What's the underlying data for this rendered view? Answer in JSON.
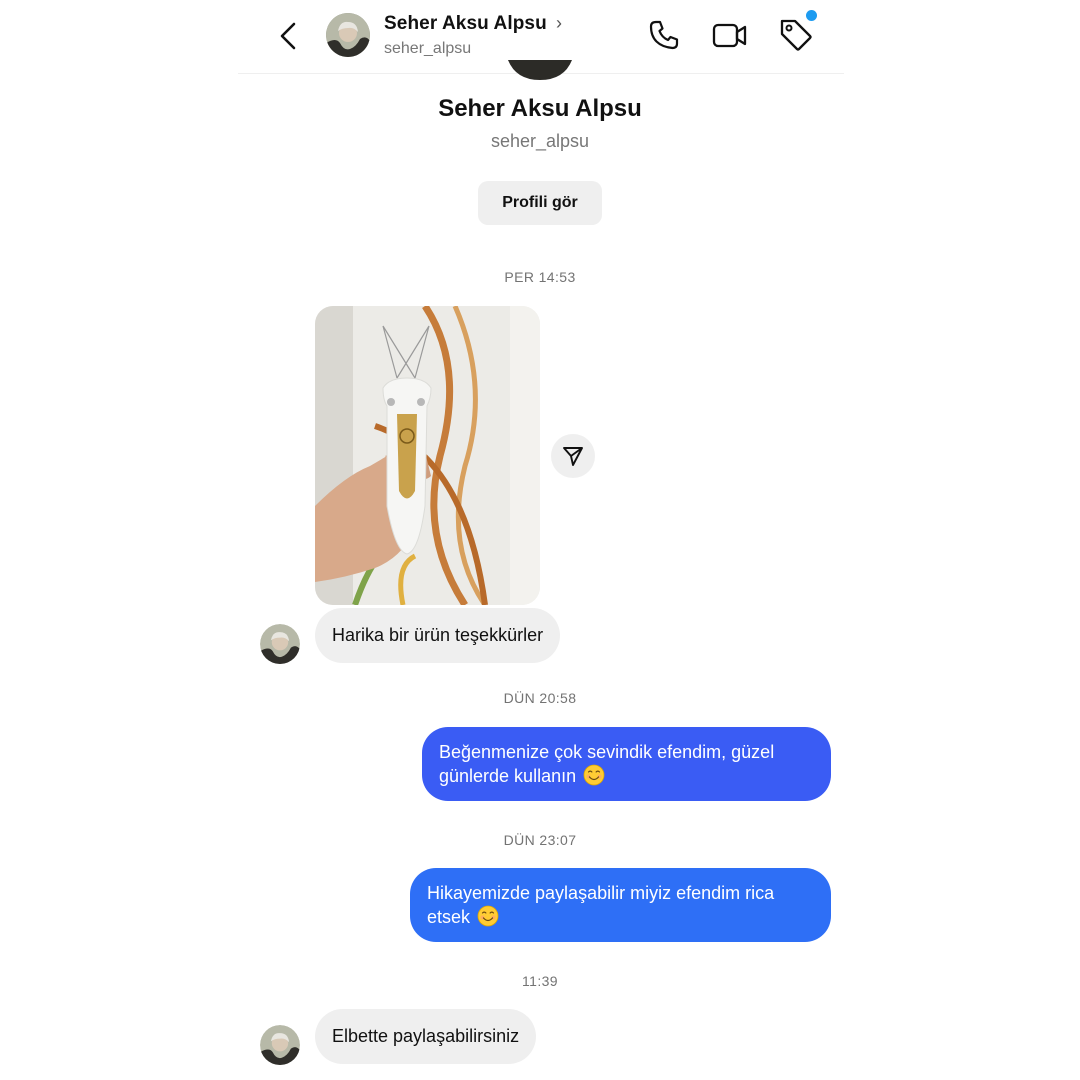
{
  "header": {
    "name": "Seher Aksu Alpsu",
    "username": "seher_alpsu",
    "chevron": "›",
    "icons": [
      "back-icon",
      "phone-icon",
      "video-icon",
      "tag-icon"
    ]
  },
  "profile": {
    "name": "Seher Aksu Alpsu",
    "username": "seher_alpsu",
    "view_button": "Profili gör"
  },
  "messages": [
    {
      "timestamp": "PER 14:53"
    },
    {
      "from": "them",
      "type": "photo",
      "caption": "photo of a white and gold facial epilator held in a hand"
    },
    {
      "from": "them",
      "text": "Harika bir ürün teşekkürler"
    },
    {
      "timestamp": "DÜN 20:58"
    },
    {
      "from": "me",
      "line1": "Beğenmenize çok sevindik efendim, güzel",
      "line2": "günlerde kullanın",
      "emoji": "smiling-face-emoji"
    },
    {
      "timestamp": "DÜN 23:07"
    },
    {
      "from": "me",
      "line1": "Hikayemizde paylaşabilir miyiz efendim rica",
      "line2": "etsek",
      "emoji": "smiling-face-emoji"
    },
    {
      "timestamp": "11:39"
    },
    {
      "from": "them",
      "text": "Elbette paylaşabilirsiniz"
    }
  ],
  "colors": {
    "outgoing_bubble": "#3b63f5",
    "incoming_bubble": "#efefef",
    "notification_dot": "#1d9bf0",
    "timestamp_text": "#737373"
  }
}
